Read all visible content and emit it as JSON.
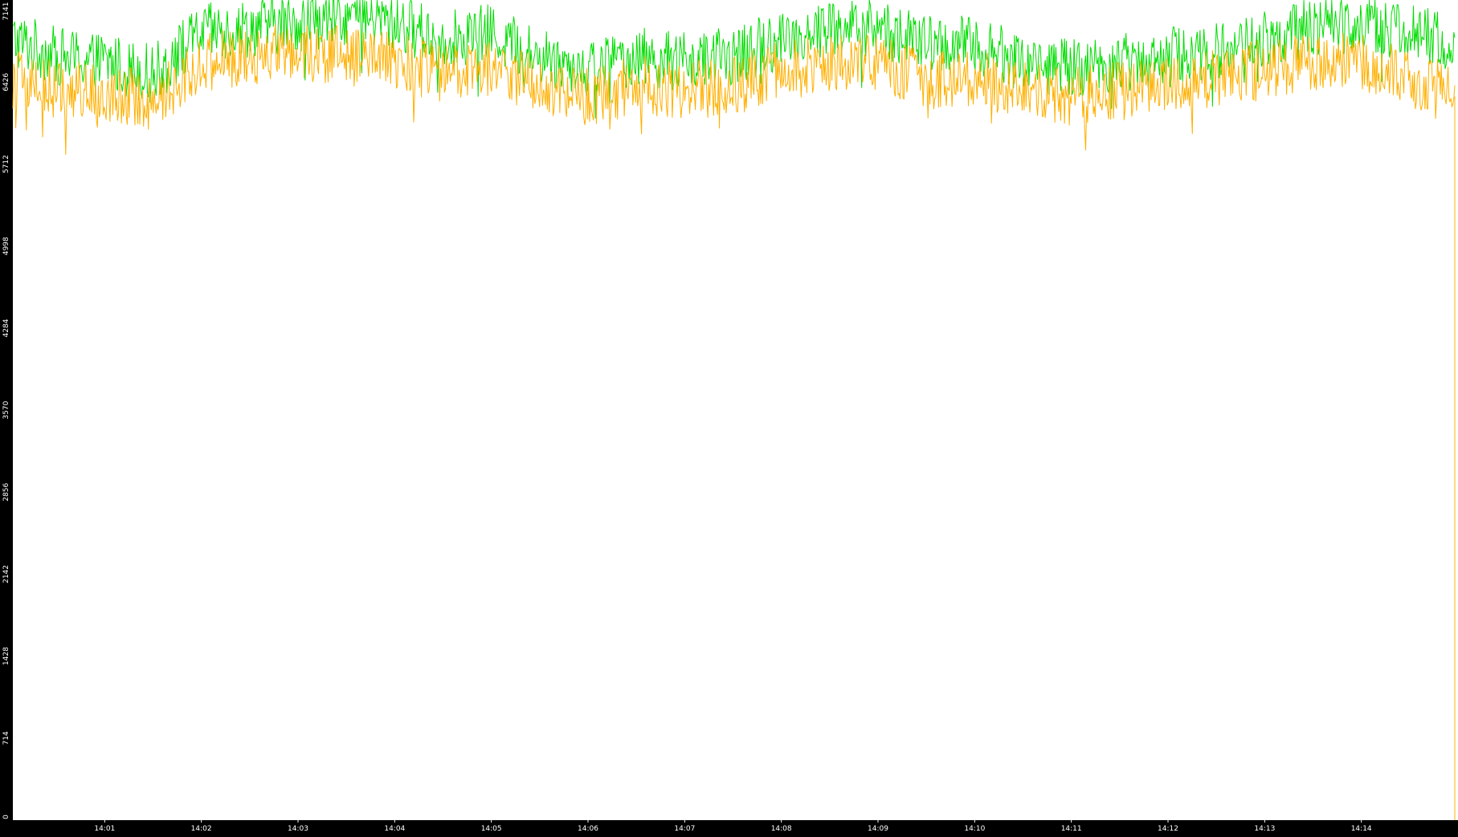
{
  "colors": {
    "background": "#000000",
    "plot_area": "#ffffff",
    "tick_text": "#ffffff",
    "series_green": "#00dd00",
    "series_orange": "#ffb000"
  },
  "chart_data": {
    "type": "line",
    "title": "",
    "xlabel": "",
    "ylabel": "",
    "grid": false,
    "legend": "none",
    "ylim": [
      0,
      7141
    ],
    "y_ticks": [
      "0",
      "714",
      "1428",
      "2142",
      "2856",
      "3570",
      "4284",
      "4998",
      "5712",
      "6426",
      "7141"
    ],
    "x_ticks": [
      "14:01",
      "14:02",
      "14:03",
      "14:04",
      "14:05",
      "14:06",
      "14:07",
      "14:08",
      "14:09",
      "14:10",
      "14:11",
      "14:12",
      "14:13",
      "14:14"
    ],
    "x_range_minutes": [
      "14:00:03",
      "14:14:58"
    ],
    "series": [
      {
        "color": "#00dd00",
        "x": [
          "14:00:03",
          "14:00:30",
          "14:01:00",
          "14:01:30",
          "14:02:00",
          "14:02:30",
          "14:03:00",
          "14:03:30",
          "14:04:00",
          "14:04:30",
          "14:05:00",
          "14:05:30",
          "14:06:00",
          "14:06:30",
          "14:07:00",
          "14:07:30",
          "14:08:00",
          "14:08:30",
          "14:09:00",
          "14:09:30",
          "14:10:00",
          "14:10:30",
          "14:11:00",
          "14:11:30",
          "14:12:00",
          "14:12:30",
          "14:13:00",
          "14:13:30",
          "14:14:00",
          "14:14:30",
          "14:14:58"
        ],
        "values": [
          6800,
          6650,
          6600,
          6500,
          6850,
          6900,
          6950,
          7000,
          6950,
          6800,
          6850,
          6650,
          6550,
          6650,
          6600,
          6650,
          6800,
          6900,
          6900,
          6750,
          6750,
          6600,
          6550,
          6600,
          6650,
          6700,
          6800,
          6900,
          6950,
          6850,
          6750
        ]
      },
      {
        "color": "#ffb000",
        "x": [
          "14:00:03",
          "14:00:30",
          "14:01:00",
          "14:01:30",
          "14:02:00",
          "14:02:30",
          "14:03:00",
          "14:03:30",
          "14:04:00",
          "14:04:30",
          "14:05:00",
          "14:05:30",
          "14:06:00",
          "14:06:30",
          "14:07:00",
          "14:07:30",
          "14:08:00",
          "14:08:30",
          "14:09:00",
          "14:09:30",
          "14:10:00",
          "14:10:30",
          "14:11:00",
          "14:11:30",
          "14:12:00",
          "14:12:30",
          "14:13:00",
          "14:13:30",
          "14:14:00",
          "14:14:30",
          "14:14:58"
        ],
        "values": [
          6450,
          6350,
          6350,
          6250,
          6600,
          6650,
          6700,
          6650,
          6600,
          6500,
          6550,
          6400,
          6300,
          6400,
          6350,
          6400,
          6550,
          6600,
          6600,
          6450,
          6450,
          6350,
          6300,
          6350,
          6400,
          6450,
          6550,
          6600,
          6600,
          6450,
          6400
        ]
      }
    ]
  }
}
